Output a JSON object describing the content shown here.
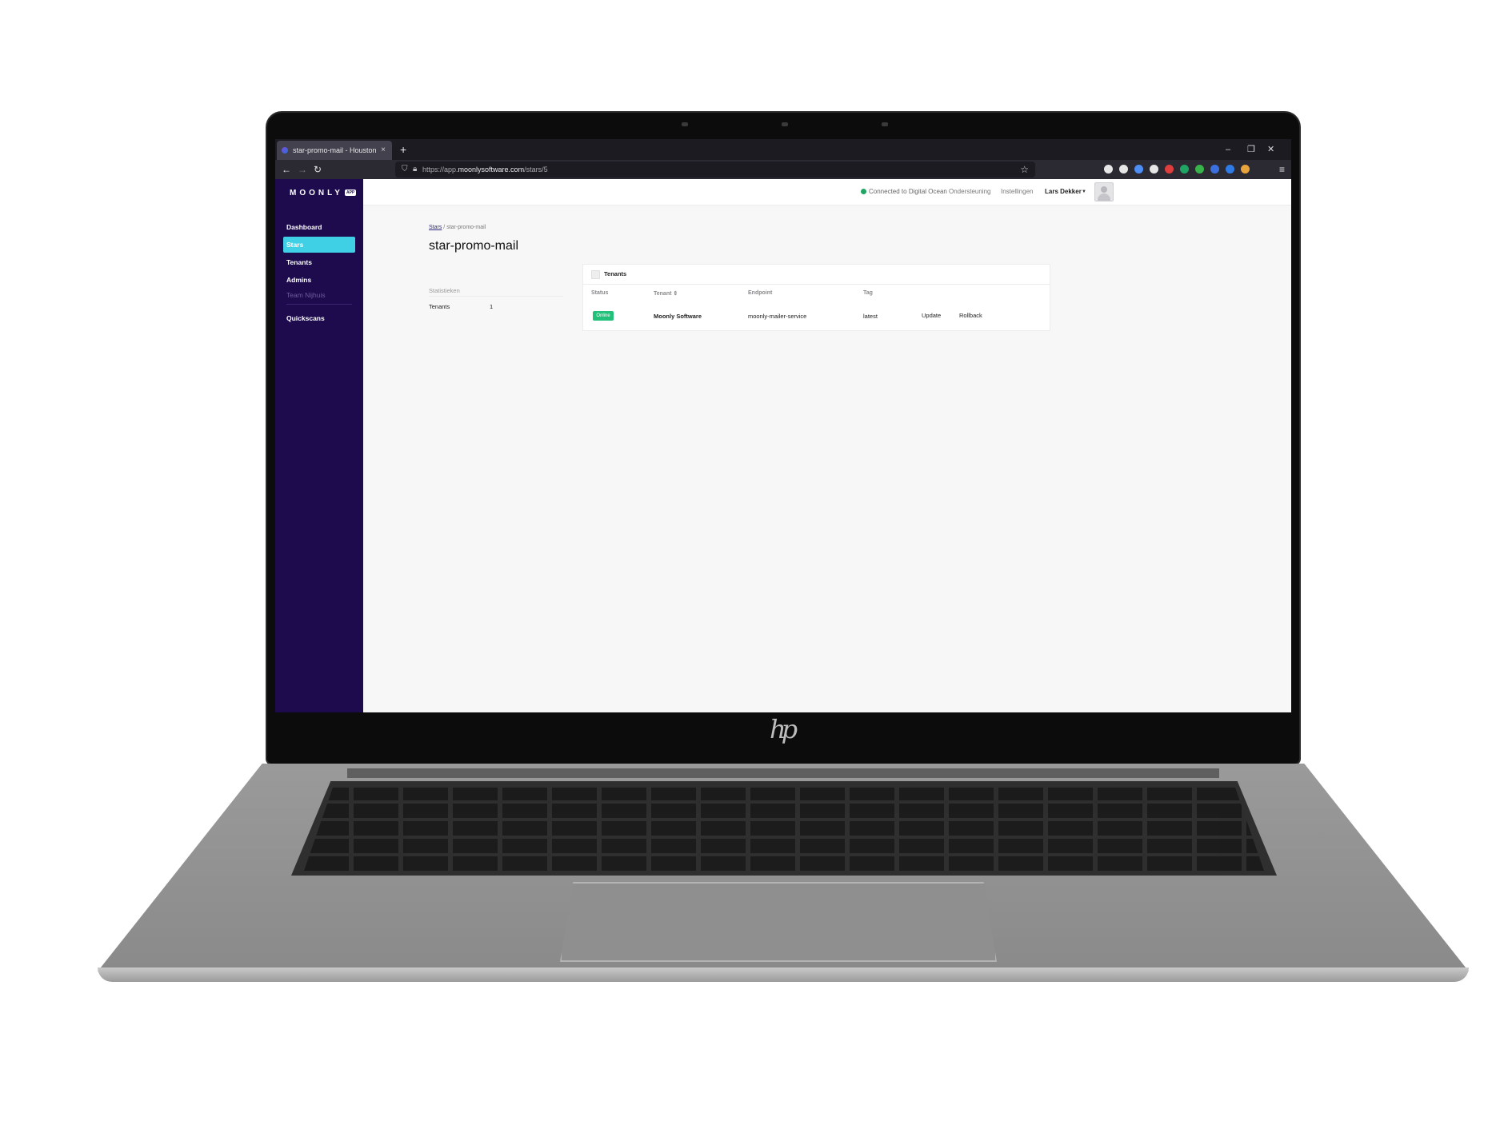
{
  "browser": {
    "tab_title": "star-promo-mail - Houston",
    "tab_close": "×",
    "new_tab": "+",
    "url_prefix": "https://app.",
    "url_host": "moonlysoftware.com",
    "url_path": "/stars/5",
    "window_controls": [
      "–",
      "❐",
      "✕"
    ],
    "extension_colors": [
      "#e6e6e6",
      "#e6e6e6",
      "#4e8ef7",
      "#e6e6e6",
      "#e03d3d",
      "#1fa463",
      "#38b44a",
      "#3b6fe0",
      "#2f7be6",
      "#e8a33d"
    ]
  },
  "app": {
    "brand": "MOONLY",
    "brand_badge": "APP",
    "sidebar": {
      "items": [
        {
          "label": "Dashboard",
          "active": false
        },
        {
          "label": "Stars",
          "active": true
        },
        {
          "label": "Tenants",
          "active": false
        },
        {
          "label": "Admins",
          "active": false
        }
      ],
      "section_label": "Team Nijhuis",
      "after_section": {
        "label": "Quickscans"
      }
    },
    "topbar": {
      "connection": "Connected to Digital Ocean",
      "connection_color": "#1fa463",
      "support": "Ondersteuning",
      "settings": "Instellingen",
      "user": "Lars Dekker"
    },
    "breadcrumb": {
      "parent": "Stars",
      "separator": "/",
      "current": "star-promo-mail"
    },
    "page_title": "star-promo-mail",
    "stats": {
      "heading": "Statistieken",
      "rows": [
        {
          "label": "Tenants",
          "value": "1"
        }
      ]
    },
    "tenants_card": {
      "title": "Tenants",
      "columns": [
        "Status",
        "Tenant ⇕",
        "Endpoint",
        "Tag"
      ],
      "rows": [
        {
          "status": "Online",
          "tenant": "Moonly Software",
          "endpoint": "moonly-mailer-service",
          "tag": "latest",
          "actions": [
            "Update",
            "Rollback"
          ]
        }
      ]
    }
  },
  "device": {
    "brand_mark": "hp"
  }
}
